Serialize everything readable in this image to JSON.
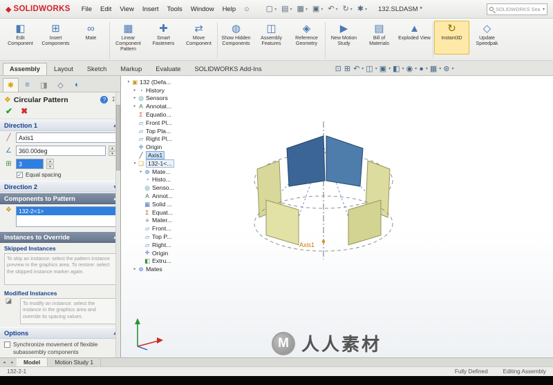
{
  "titlebar": {
    "logo": "SOLIDWORKS",
    "menus": [
      "File",
      "Edit",
      "View",
      "Insert",
      "Tools",
      "Window",
      "Help"
    ],
    "quick_tools": [
      "new",
      "open",
      "save",
      "print",
      "undo",
      "rebuild",
      "options"
    ],
    "document_title": "132.SLDASM *",
    "search": {
      "placeholder": "SOLIDWORKS Search"
    }
  },
  "ribbon": {
    "buttons": [
      {
        "label": "Edit Component"
      },
      {
        "label": "Insert Components"
      },
      {
        "label": "Mate"
      },
      {
        "label": "Linear Component Pattern"
      },
      {
        "label": "Smart Fasteners"
      },
      {
        "label": "Move Component"
      },
      {
        "label": "Show Hidden Components"
      },
      {
        "label": "Assembly Features"
      },
      {
        "label": "Reference Geometry"
      },
      {
        "label": "New Motion Study"
      },
      {
        "label": "Bill of Materials"
      },
      {
        "label": "Exploded View"
      },
      {
        "label": "Instant3D",
        "highlighted": true
      },
      {
        "label": "Update Speedpak"
      }
    ]
  },
  "tabbar": {
    "tabs": [
      "Assembly",
      "Layout",
      "Sketch",
      "Markup",
      "Evaluate",
      "SOLIDWORKS Add-Ins"
    ],
    "active_tab": "Assembly",
    "view_tools": [
      "zoom-fit",
      "zoom-area",
      "previous-view",
      "section-view",
      "view-orientation",
      "display-style",
      "hide-show-items",
      "edit-appearance",
      "apply-scene",
      "view-settings"
    ]
  },
  "property_panel": {
    "manager_tabs": [
      "property-manager",
      "feature-manager",
      "configuration-manager",
      "dimxpert-manager",
      "display-manager"
    ],
    "title": "Circular Pattern",
    "direction1": {
      "header": "Direction 1",
      "axis_value": "Axis1",
      "angle_value": "360.00deg",
      "instances_value": "3",
      "equal_spacing_label": "Equal spacing"
    },
    "direction2": {
      "header": "Direction 2"
    },
    "components": {
      "header": "Components to Pattern",
      "selected_item": "132-2<1>"
    },
    "overrides": {
      "header": "Instances to Override",
      "skipped_label": "Skipped Instances",
      "skipped_hint": "To skip an instance: select the pattern instance preview in the graphics area. To restore: select the skipped instance marker again.",
      "modified_label": "Modified Instances",
      "modified_hint": "To modify an instance: select the instance in the graphics area and override its spacing values."
    },
    "options": {
      "header": "Options",
      "sync_label": "Synchronize movement of flexible subassembly components"
    }
  },
  "feature_tree": {
    "items": [
      {
        "label": "132 (Defa...",
        "icon": "assembly",
        "level": 0,
        "arrow": "expanded"
      },
      {
        "label": "History",
        "icon": "history",
        "level": 1,
        "arrow": "collapsed"
      },
      {
        "label": "Sensors",
        "icon": "sensor",
        "level": 1,
        "arrow": "collapsed"
      },
      {
        "label": "Annotat...",
        "icon": "annotations",
        "level": 1,
        "arrow": "collapsed"
      },
      {
        "label": "Equatio...",
        "icon": "equations",
        "level": 1
      },
      {
        "label": "Front Pl...",
        "icon": "plane",
        "level": 1
      },
      {
        "label": "Top Pla...",
        "icon": "plane",
        "level": 1
      },
      {
        "label": "Right Pl...",
        "icon": "plane",
        "level": 1
      },
      {
        "label": "Origin",
        "icon": "origin",
        "level": 1
      },
      {
        "label": "Axis1",
        "icon": "axis",
        "level": 1,
        "selected": true
      },
      {
        "label": "132-1<...",
        "icon": "part",
        "level": 1,
        "arrow": "expanded",
        "boxed": true
      },
      {
        "label": "Mate...",
        "icon": "mates",
        "level": 2,
        "arrow": "collapsed"
      },
      {
        "label": "Histo...",
        "icon": "history",
        "level": 2
      },
      {
        "label": "Senso...",
        "icon": "sensor",
        "level": 2
      },
      {
        "label": "Annot...",
        "icon": "annotations",
        "level": 2
      },
      {
        "label": "Solid ...",
        "icon": "solidbodies",
        "level": 2
      },
      {
        "label": "Equat...",
        "icon": "equations",
        "level": 2
      },
      {
        "label": "Mater...",
        "icon": "material",
        "level": 2
      },
      {
        "label": "Front...",
        "icon": "plane",
        "level": 2
      },
      {
        "label": "Top P...",
        "icon": "plane",
        "level": 2
      },
      {
        "label": "Right...",
        "icon": "plane",
        "level": 2
      },
      {
        "label": "Origin",
        "icon": "origin",
        "level": 2
      },
      {
        "label": "Extru...",
        "icon": "feature",
        "level": 2
      },
      {
        "label": "Mates",
        "icon": "mates",
        "level": 1,
        "arrow": "collapsed"
      }
    ]
  },
  "viewport": {
    "axis_label": "Axis1"
  },
  "bottom_tabs": {
    "tabs": [
      "Model",
      "Motion Study 1"
    ],
    "active": "Model"
  },
  "statusbar": {
    "left": "132-2-1",
    "status": "Fully Defined",
    "mode": "Editing Assembly"
  },
  "watermark": {
    "logo_letter": "M",
    "cjk": "人人素材"
  }
}
